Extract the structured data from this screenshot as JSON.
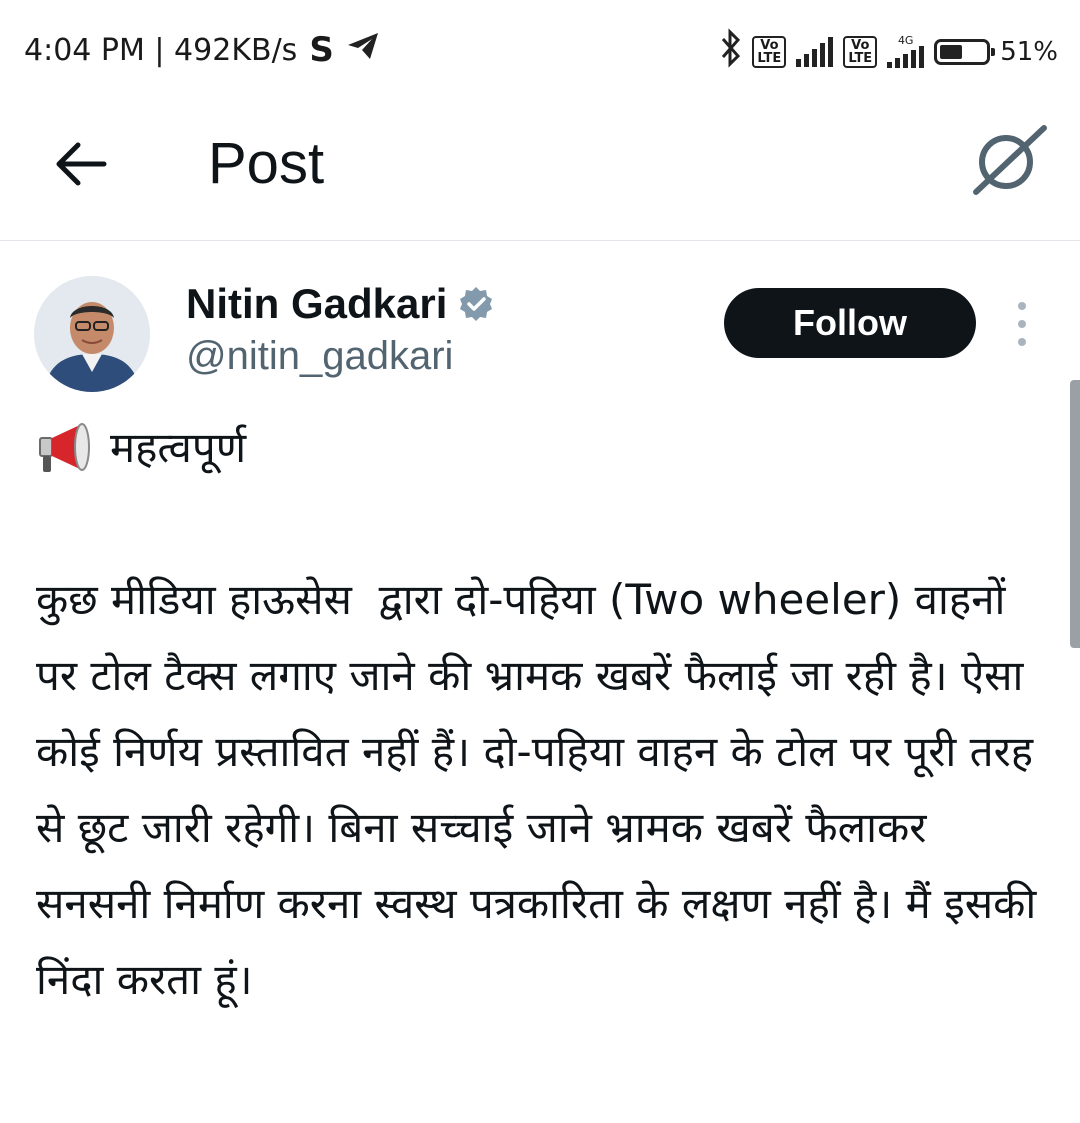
{
  "status_bar": {
    "time_speed": "4:04 PM | 492KB/s",
    "left_icons": [
      "s-app-icon",
      "telegram-icon"
    ],
    "volte_label": "Vo\nLTE",
    "network_label": "4G",
    "battery_percent_text": "51%",
    "battery_level": 0.51
  },
  "header": {
    "title": "Post"
  },
  "author": {
    "name": "Nitin Gadkari",
    "handle": "@nitin_gadkari",
    "verified": true,
    "follow_label": "Follow"
  },
  "tweet": {
    "headline": "महत्वपूर्ण",
    "body": "कुछ मीडिया हाऊसेस  द्वारा दो-पहिया (Two wheeler) वाहनों पर टोल टैक्स लगाए जाने की भ्रामक खबरें फैलाई जा रही है। ऐसा कोई निर्णय प्रस्तावित नहीं हैं। दो-पहिया वाहन के टोल पर पूरी तरह से छूट जारी रहेगी। बिना सच्चाई जाने भ्रामक खबरें फैलाकर सनसनी निर्माण करना स्वस्थ पत्रकारिता के लक्षण नहीं है। मैं इसकी निंदा करता हूं।"
  },
  "colors": {
    "text": "#0f1419",
    "secondary": "#536471",
    "verified_badge": "#829aab",
    "follow_bg": "#0f1419",
    "megaphone": "#d6262b"
  }
}
